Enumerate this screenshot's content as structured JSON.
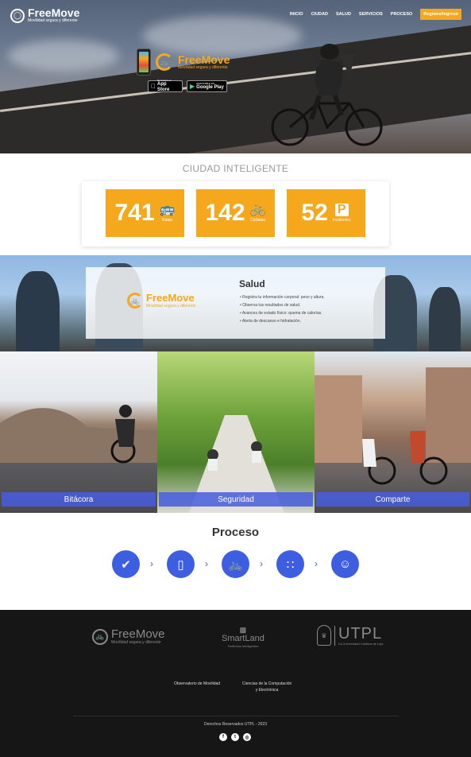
{
  "header": {
    "logo_title": "FreeMove",
    "logo_subtitle": "Movilidad segura y diferente",
    "menu": [
      "INICIO",
      "CIUDAD",
      "SALUD",
      "SERVICIOS",
      "PROCESO"
    ],
    "register_label": "Registro/Ingreso"
  },
  "hero": {
    "app_title": "FreeMove",
    "app_subtitle": "Movilidad segura y diferente",
    "appstore_small": "Descargar en",
    "appstore_big": "App Store",
    "googleplay_small": "DISPONIBLE EN",
    "googleplay_big": "Google Play"
  },
  "ciudad": {
    "title": "CIUDAD INTELIGENTE",
    "stats": [
      {
        "value": "741",
        "label": "Rutas",
        "icon": "bus-icon"
      },
      {
        "value": "142",
        "label": "Ciclistas",
        "icon": "cyclist-icon"
      },
      {
        "value": "52",
        "label": "Incidentes",
        "icon": "parking-icon"
      }
    ]
  },
  "salud": {
    "logo_title": "FreeMove",
    "logo_subtitle": "Movilidad segura y diferente",
    "title": "Salud",
    "items": [
      "Registra tu información corporal: peso y altura.",
      "Observa tus resultados de salud.",
      "Avances de estado físico: quema de calorías.",
      "Alerta de descanso e hidratación."
    ]
  },
  "panels": [
    {
      "label": "Bitácora"
    },
    {
      "label": "Seguridad"
    },
    {
      "label": "Comparte"
    }
  ],
  "proceso": {
    "title": "Proceso",
    "steps": [
      "check-icon",
      "phone-icon",
      "bike-icon",
      "chart-icon",
      "smile-icon"
    ]
  },
  "footer": {
    "freemove_title": "FreeMove",
    "freemove_subtitle": "Movilidad segura y diferente",
    "smartland_title": "SmartLand",
    "smartland_subtitle": "Territorios inteligentes",
    "utpl_title": "UTPL",
    "utpl_subtitle": "La Universidad Católica de Loja",
    "link1": "Observatorio de Movilidad",
    "link2_line1": "Ciencias de la Computación",
    "link2_line2": "y Electrónica",
    "copyright": "Derechos Reservados UTPL - 2023",
    "social": [
      "facebook-icon",
      "twitter-icon",
      "instagram-icon"
    ]
  },
  "colors": {
    "accent": "#f5a81c",
    "primary": "#3d5ee1",
    "footer_bg": "#161616"
  }
}
